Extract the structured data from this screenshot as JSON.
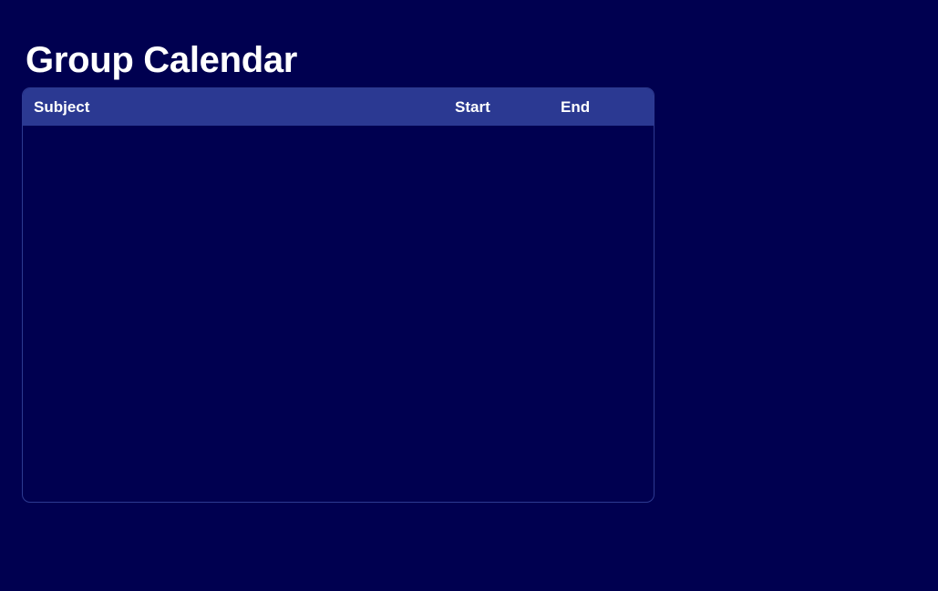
{
  "page": {
    "title": "Group Calendar"
  },
  "table": {
    "columns": {
      "subject": "Subject",
      "start": "Start",
      "end": "End"
    },
    "rows": [
      {
        "subject": "",
        "start": "",
        "end": ""
      },
      {
        "subject": "",
        "start": "",
        "end": ""
      },
      {
        "subject": "",
        "start": "",
        "end": ""
      },
      {
        "subject": "",
        "start": "",
        "end": ""
      },
      {
        "subject": "",
        "start": "",
        "end": ""
      },
      {
        "subject": "",
        "start": "",
        "end": ""
      },
      {
        "subject": "",
        "start": "",
        "end": ""
      },
      {
        "subject": "",
        "start": "",
        "end": ""
      },
      {
        "subject": "",
        "start": "",
        "end": ""
      },
      {
        "subject": "",
        "start": "",
        "end": ""
      }
    ]
  },
  "colors": {
    "background": "#000050",
    "header_bg": "#2b3992",
    "border": "#2d3a91",
    "text": "#ffffff"
  }
}
